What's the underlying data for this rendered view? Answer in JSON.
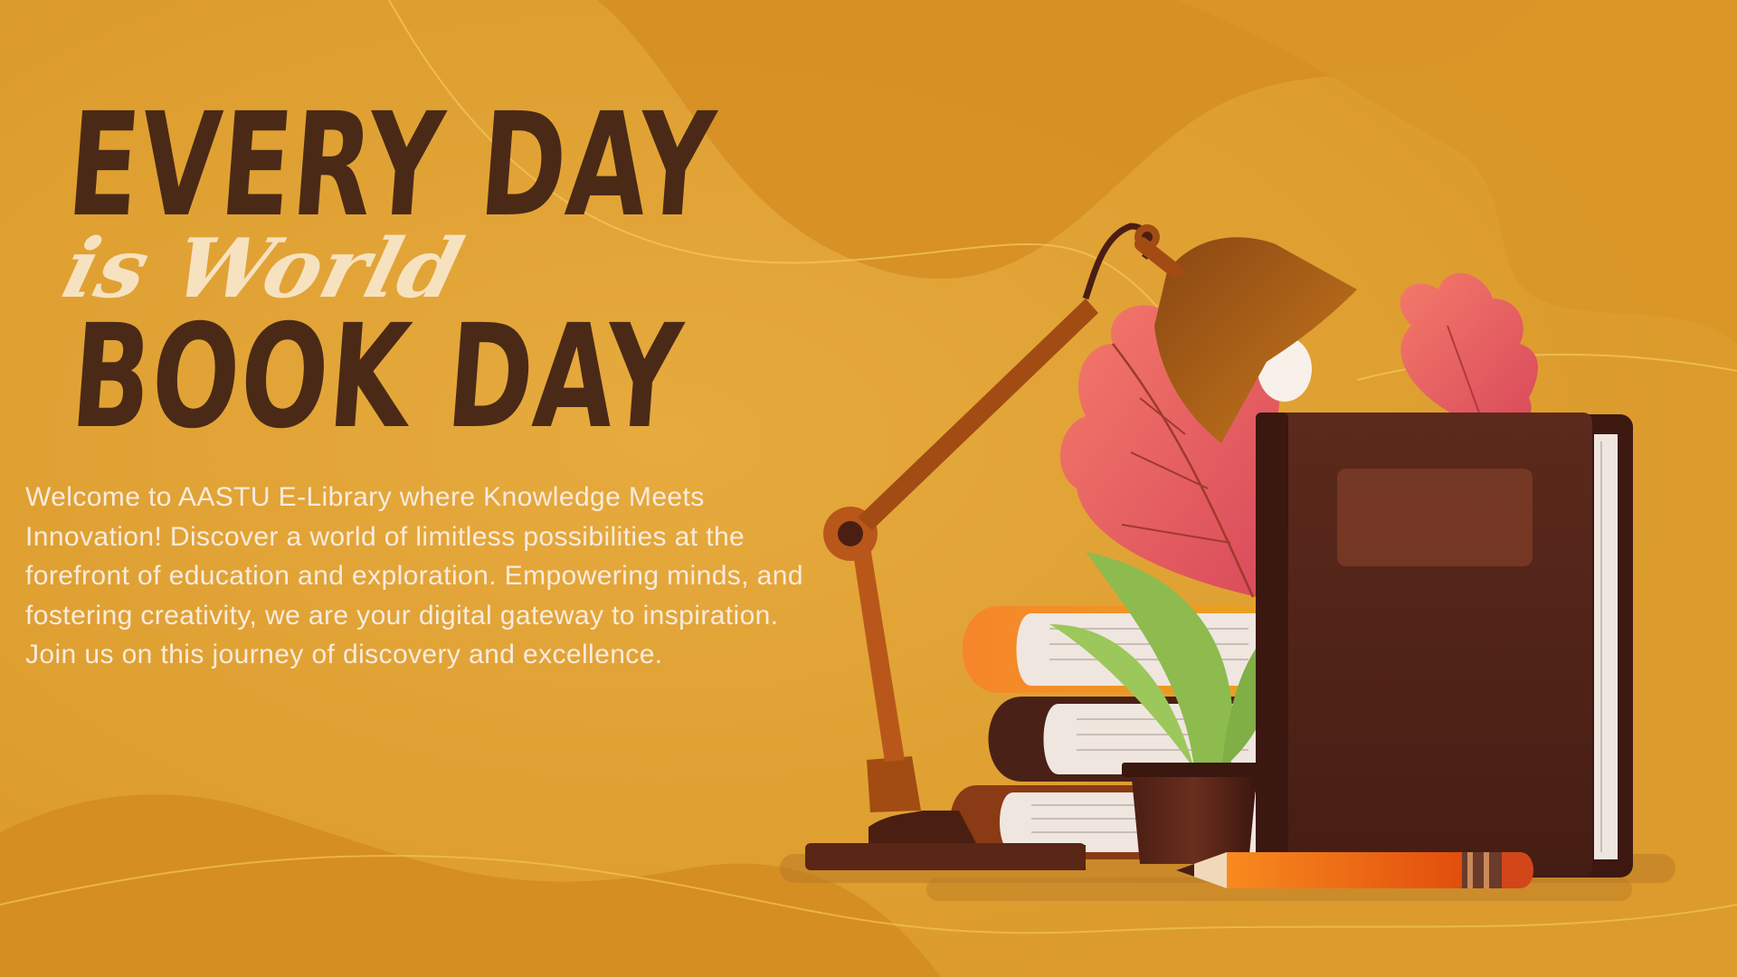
{
  "headline": {
    "line1": "EVERY DAY",
    "line2": "is World",
    "line3": "BOOK DAY"
  },
  "intro": {
    "text": "Welcome to AASTU E-Library where Knowledge Meets Innovation! Discover a world of limitless possibilities at the forefront of education and exploration. Empowering minds, and fostering creativity, we are your digital gateway to inspiration. Join us on this journey of discovery and excellence."
  },
  "colors": {
    "background": "#E0A233",
    "headline_dark": "#4A2A17",
    "headline_script": "#F7E2C0",
    "body_text": "#F8EBDD"
  },
  "illustration": {
    "icons": [
      "desk-lamp-icon",
      "book-stack-icon",
      "potted-plant-icon",
      "leaf-icon",
      "hardcover-book-icon",
      "pencil-icon"
    ]
  }
}
